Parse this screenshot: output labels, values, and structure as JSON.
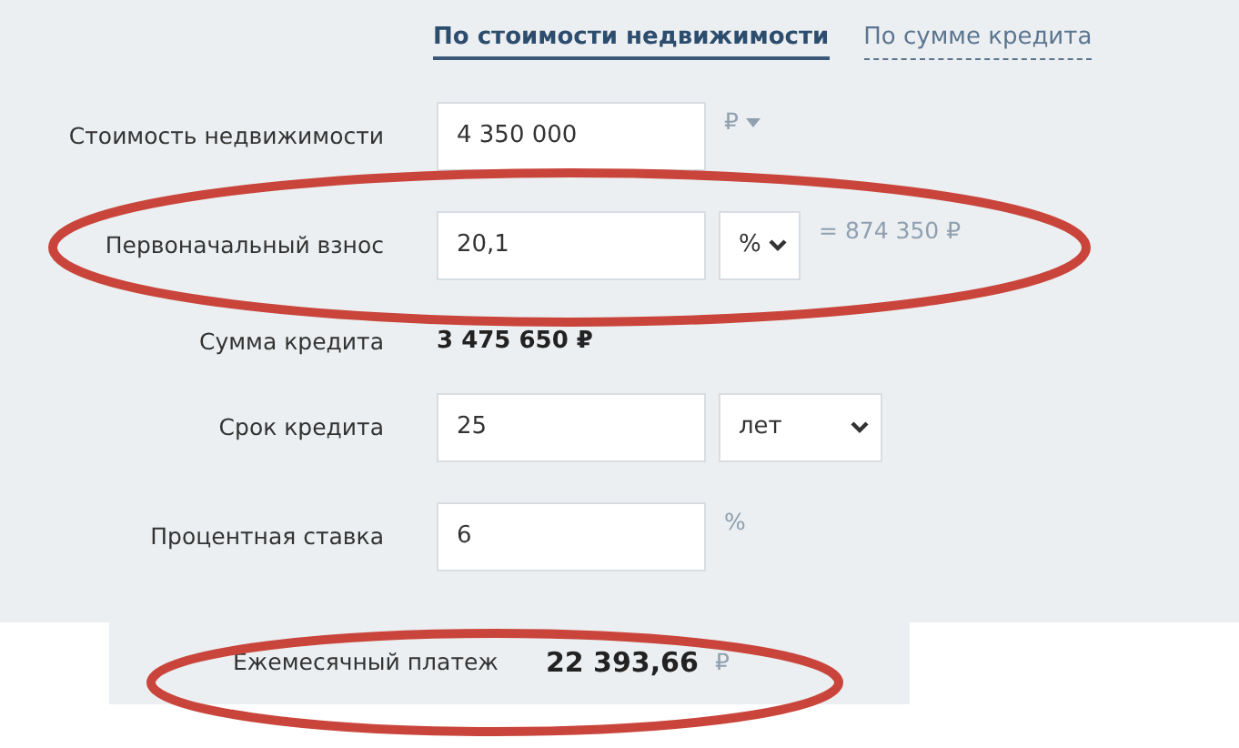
{
  "tabs": [
    {
      "label": "По стоимости недвижимости",
      "selected": true
    },
    {
      "label": "По сумме кредита",
      "selected": false
    }
  ],
  "fields": [
    {
      "kind": "input",
      "label": "Стоимость недвижимости",
      "value": "4 350 000",
      "unit": "₽",
      "unit_dropdown": true
    },
    {
      "kind": "input_select",
      "label": "Первоначальный взнос",
      "value": "20,1",
      "select": "%",
      "note": "= 874 350 ₽"
    },
    {
      "kind": "readout",
      "label": "Сумма кредита",
      "value": "3 475 650 ₽"
    },
    {
      "kind": "input_select",
      "label": "Срок кредита",
      "value": "25",
      "select": "лет"
    },
    {
      "kind": "input",
      "label": "Процентная ставка",
      "value": "6",
      "unit": "%"
    }
  ],
  "result": {
    "label": "Ежемесячный платеж",
    "value": "22 393,66",
    "currency": "₽"
  }
}
